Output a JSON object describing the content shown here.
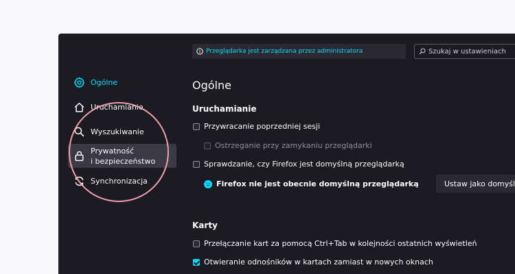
{
  "policy_notice": "Przeglądarka jest zarządzana przez administratora",
  "search": {
    "placeholder": "Szukaj w ustawieniach"
  },
  "sidebar": {
    "items": [
      {
        "label": "Ogólne",
        "icon": "gear-icon"
      },
      {
        "label": "Uruchamianie",
        "icon": "home-icon"
      },
      {
        "label": "Wyszukiwanie",
        "icon": "search-icon"
      },
      {
        "label_line1": "Prywatność",
        "label_line2": "i bezpieczeństwo",
        "icon": "lock-icon"
      },
      {
        "label": "Synchronizacja",
        "icon": "sync-icon"
      }
    ]
  },
  "main": {
    "title": "Ogólne",
    "startup": {
      "heading": "Uruchamianie",
      "restore_session": "Przywracanie poprzedniej sesji",
      "warn_on_quit": "Ostrzeganie przy zamykaniu przeglądarki",
      "check_default": "Sprawdzanie, czy Firefox jest domyślną przeglądarką",
      "default_status": "Firefox nie jest obecnie domyślną przeglądarką",
      "set_default_button": "Ustaw jako domyślną"
    },
    "tabs": {
      "heading": "Karty",
      "ctrl_tab": "Przełączanie kart za pomocą Ctrl+Tab w kolejności ostatnich wyświetleń",
      "open_links_in_tabs": "Otwieranie odnośników w kartach zamiast w nowych oknach"
    }
  },
  "colors": {
    "accent": "#00ddff",
    "background": "#1c1b22",
    "highlight_ring": "#f0a0ad"
  }
}
